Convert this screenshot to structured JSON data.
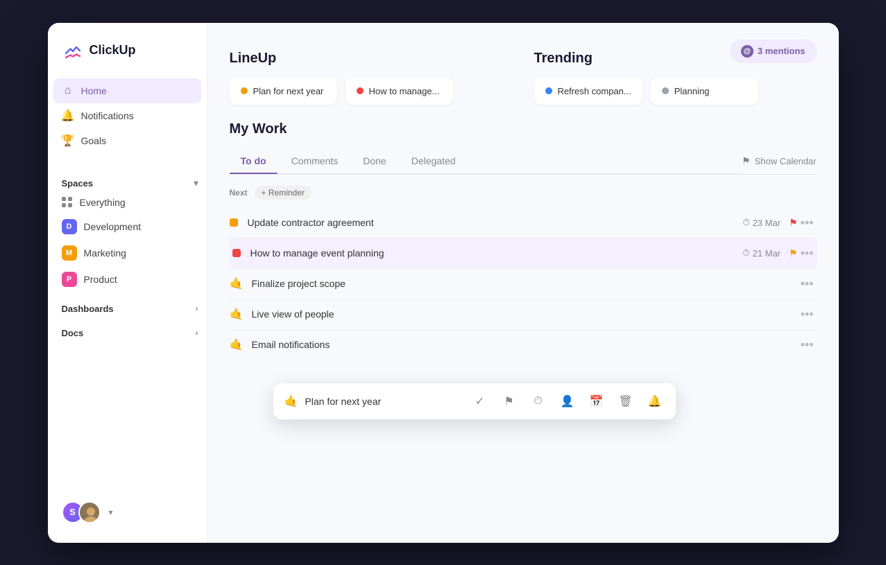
{
  "app": {
    "name": "ClickUp"
  },
  "sidebar": {
    "logo": "ClickUp",
    "nav": [
      {
        "id": "home",
        "label": "Home",
        "icon": "home",
        "active": true
      },
      {
        "id": "notifications",
        "label": "Notifications",
        "icon": "bell"
      },
      {
        "id": "goals",
        "label": "Goals",
        "icon": "trophy"
      }
    ],
    "spaces_label": "Spaces",
    "spaces": [
      {
        "id": "everything",
        "label": "Everything",
        "icon": "grid"
      },
      {
        "id": "development",
        "label": "Development",
        "color": "#6366f1",
        "letter": "D"
      },
      {
        "id": "marketing",
        "label": "Marketing",
        "color": "#f59e0b",
        "letter": "M"
      },
      {
        "id": "product",
        "label": "Product",
        "color": "#ec4899",
        "letter": "P"
      }
    ],
    "dashboards_label": "Dashboards",
    "docs_label": "Docs"
  },
  "header": {
    "mentions_label": "3 mentions"
  },
  "lineup": {
    "title": "LineUp",
    "cards": [
      {
        "label": "Plan for next year",
        "dot": "orange"
      },
      {
        "label": "How to manage...",
        "dot": "red"
      }
    ]
  },
  "trending": {
    "title": "Trending",
    "cards": [
      {
        "label": "Refresh compan...",
        "dot": "blue"
      },
      {
        "label": "Planning",
        "dot": "gray"
      }
    ]
  },
  "my_work": {
    "title": "My Work",
    "tabs": [
      "To do",
      "Comments",
      "Done",
      "Delegated"
    ],
    "active_tab": "To do",
    "show_calendar": "Show Calendar",
    "next_label": "Next",
    "reminder_label": "+ Reminder",
    "tasks": [
      {
        "id": 1,
        "name": "Update contractor agreement",
        "status_color": "#f59e0b",
        "date": "23 Mar",
        "flag_color": "#ef4444",
        "has_meta": true
      },
      {
        "id": 2,
        "name": "How to manage event planning",
        "status_color": "#ef4444",
        "date": "21 Mar",
        "flag_color": "#f59e0b",
        "has_meta": true,
        "highlight": true
      },
      {
        "id": 3,
        "name": "Finalize project scope",
        "emoji": "🤙",
        "has_meta": false
      },
      {
        "id": 4,
        "name": "Live view of people",
        "emoji": "🤙",
        "has_meta": false
      },
      {
        "id": 5,
        "name": "Email notifications",
        "emoji": "🤙",
        "has_meta": false
      }
    ]
  },
  "tooltip": {
    "task_name": "Plan for next year",
    "actions": [
      "check",
      "flag",
      "clock",
      "person",
      "calendar",
      "trash",
      "bell"
    ]
  }
}
